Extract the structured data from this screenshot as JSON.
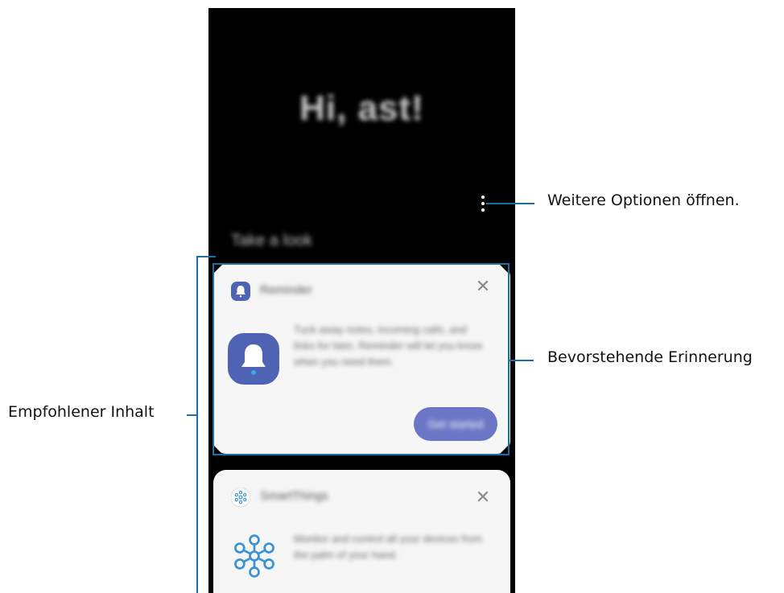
{
  "screen": {
    "greeting": "Hi, ast!",
    "section_title": "Take a look"
  },
  "reminder_card": {
    "app_name": "Reminder",
    "description": "Tuck away notes, incoming calls, and links for later. Reminder will let you know when you need them.",
    "button_label": "Get started",
    "icon": "bell-icon"
  },
  "smartthings_card": {
    "app_name": "SmartThings",
    "description": "Monitor and control all your devices from the palm of your hand.",
    "icon": "network-nodes-icon"
  },
  "annotations": {
    "more_options": "Weitere Optionen öffnen.",
    "upcoming_reminder": "Bevorstehende Erinnerung",
    "recommended_content": "Empfohlener Inhalt"
  },
  "colors": {
    "accent": "#1d6fa5",
    "reminder_icon": "#4f63b4",
    "button": "#6c76c6",
    "smartthings_icon": "#3b93d6"
  }
}
